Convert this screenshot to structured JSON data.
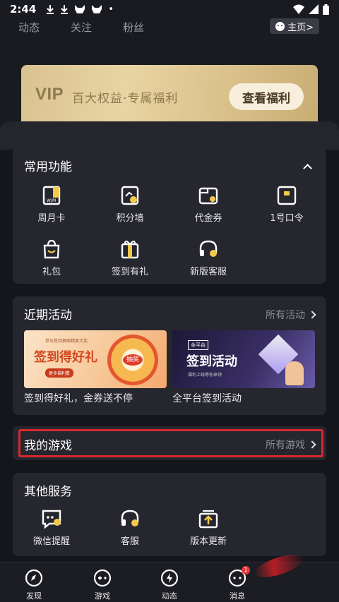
{
  "status_bar": {
    "time": "2:44",
    "dot": "•"
  },
  "top_tabs": {
    "dynamic": "动态",
    "follow": "关注",
    "fans": "粉丝",
    "homepage_button": "主页>"
  },
  "vip": {
    "title": "VIP",
    "subtitle": "百大权益·专属福利",
    "button": "查看福利"
  },
  "common_functions": {
    "title": "常用功能",
    "items": [
      {
        "label": "周月卡",
        "icon": "monthly-card-icon"
      },
      {
        "label": "积分墙",
        "icon": "points-wall-icon"
      },
      {
        "label": "代金券",
        "icon": "voucher-icon"
      },
      {
        "label": "1号口令",
        "icon": "code-word-icon"
      },
      {
        "label": "礼包",
        "icon": "gift-bag-icon"
      },
      {
        "label": "签到有礼",
        "icon": "checkin-gift-icon"
      },
      {
        "label": "新版客服",
        "icon": "customer-service-icon"
      }
    ]
  },
  "recent_activities": {
    "title": "近期活动",
    "more": "所有活动",
    "banners": [
      {
        "caption": "签到得好礼，金券送不停",
        "headline": "签到得好礼",
        "tagline": "参与签到抽取精美大奖",
        "button": "更多福利看",
        "badge": "抽奖"
      },
      {
        "caption": "全平台签到活动",
        "tag": "全平台",
        "headline": "签到活动",
        "tagline": "福利上线等你来领"
      }
    ]
  },
  "my_games": {
    "title": "我的游戏",
    "more": "所有游戏"
  },
  "other_services": {
    "title": "其他服务",
    "items": [
      {
        "label": "微信提醒",
        "icon": "wechat-reminder-icon"
      },
      {
        "label": "客服",
        "icon": "service-icon"
      },
      {
        "label": "版本更新",
        "icon": "version-update-icon"
      }
    ]
  },
  "bottom_nav": {
    "items": [
      {
        "label": "发现",
        "icon": "compass-icon"
      },
      {
        "label": "游戏",
        "icon": "gamepad-icon"
      },
      {
        "label": "动态",
        "icon": "lightning-icon"
      },
      {
        "label": "消息",
        "icon": "message-icon"
      }
    ],
    "badge": "1"
  },
  "colors": {
    "accent_yellow": "#f2c94c",
    "card_bg": "#25262e",
    "highlight_red": "#d8282f",
    "vip_gold": "#e0c894"
  }
}
